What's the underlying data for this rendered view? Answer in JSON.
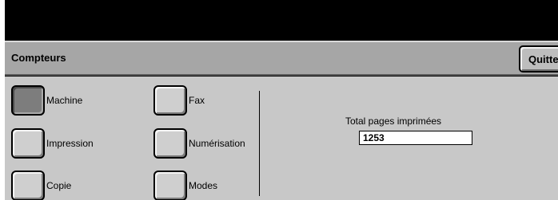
{
  "header": {
    "title": "Compteurs",
    "quit_label": "Quitter"
  },
  "options": {
    "machine": {
      "label": "Machine",
      "selected": true
    },
    "impression": {
      "label": "Impression"
    },
    "copie": {
      "label": "Copie"
    },
    "fax": {
      "label": "Fax"
    },
    "numerisation": {
      "label": "Numérisation"
    },
    "modes": {
      "label": "Modes"
    }
  },
  "counter": {
    "label": "Total pages imprimées",
    "value": "1253"
  }
}
